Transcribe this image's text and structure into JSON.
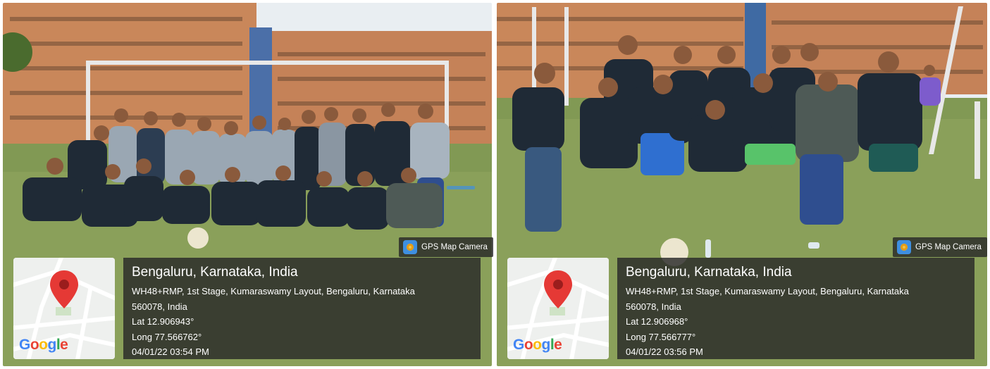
{
  "watermark_app": "GPS Map Camera",
  "map_brand": {
    "letters": [
      "G",
      "o",
      "o",
      "g",
      "l",
      "e"
    ]
  },
  "photos": [
    {
      "location_title": "Bengaluru, Karnataka, India",
      "address_line1": "WH48+RMP, 1st Stage, Kumaraswamy Layout, Bengaluru, Karnataka",
      "address_line2": "560078, India",
      "latitude": "Lat 12.906943°",
      "longitude": "Long 77.566762°",
      "datetime": "04/01/22 03:54 PM"
    },
    {
      "location_title": "Bengaluru, Karnataka, India",
      "address_line1": "WH48+RMP, 1st Stage, Kumaraswamy Layout, Bengaluru, Karnataka",
      "address_line2": "560078, India",
      "latitude": "Lat 12.906968°",
      "longitude": "Long 77.566777°",
      "datetime": "04/01/22 03:56 PM"
    }
  ],
  "colors": {
    "building": "#c9875a",
    "sky": "#e9eef2",
    "grass": "#8aa05a",
    "jersey_dark": "#1f2a36",
    "jersey_light": "#9aa7b3",
    "overlay": "#282828",
    "map_pin": "#e53935"
  }
}
